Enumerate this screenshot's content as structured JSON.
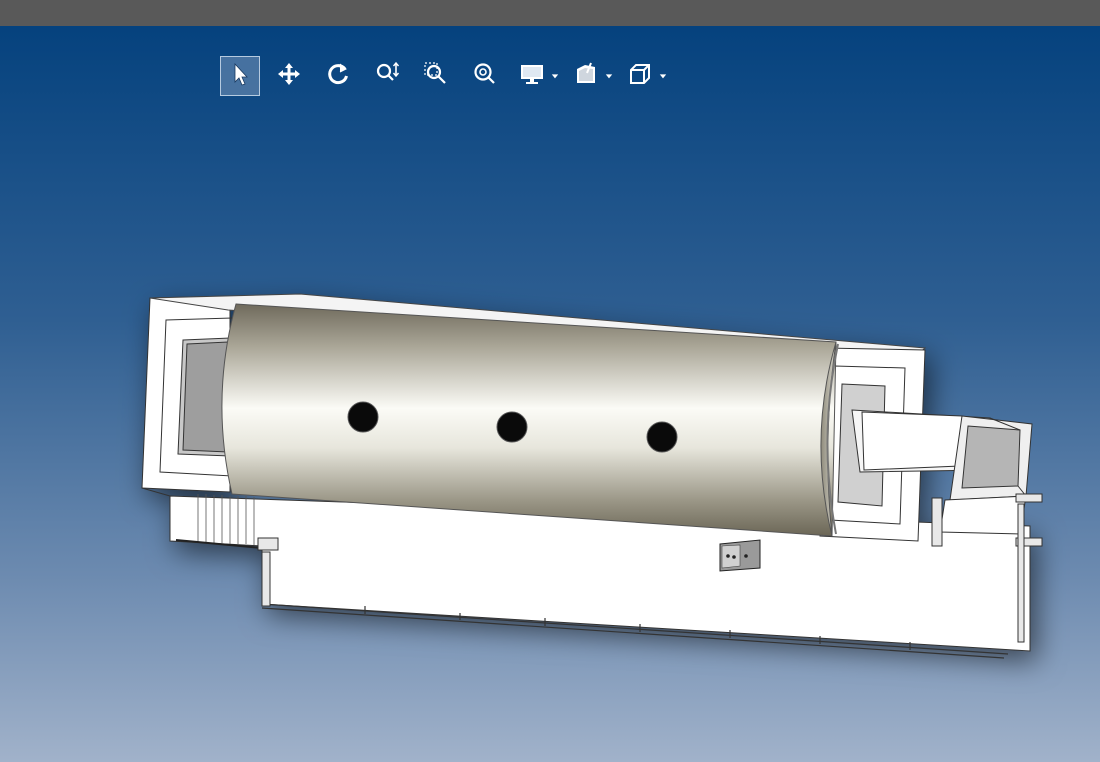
{
  "app": {
    "title_bar_color": "#595959",
    "viewport_gradient": [
      "#05427e",
      "#2f5f92",
      "#6d8bb0",
      "#a1b2ca"
    ]
  },
  "toolbar": {
    "tools": [
      {
        "name": "select",
        "icon": "cursor-arrow-icon",
        "active": true
      },
      {
        "name": "pan",
        "icon": "pan-arrows-icon",
        "active": false
      },
      {
        "name": "rotate",
        "icon": "rotate-icon",
        "active": false
      },
      {
        "name": "zoom",
        "icon": "zoom-updown-icon",
        "active": false
      },
      {
        "name": "zoom-window",
        "icon": "zoom-window-icon",
        "active": false
      },
      {
        "name": "zoom-fit",
        "icon": "zoom-fit-icon",
        "active": false
      }
    ],
    "dropdowns": [
      {
        "name": "display-mode",
        "icon": "monitor-icon"
      },
      {
        "name": "section",
        "icon": "section-cube-icon"
      },
      {
        "name": "view-orientation",
        "icon": "cube-view-icon"
      }
    ]
  },
  "model": {
    "description_icon": "cad-assembly",
    "hole_count": 3
  }
}
